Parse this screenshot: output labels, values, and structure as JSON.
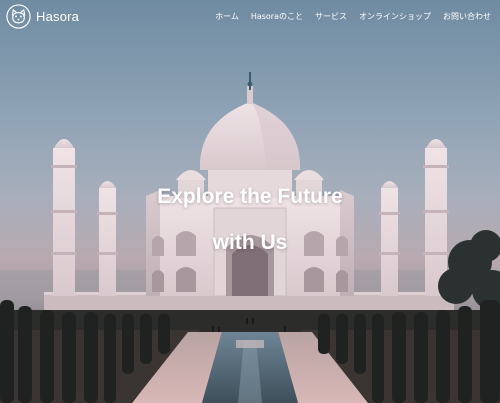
{
  "brand": {
    "name": "Hasora",
    "logo_icon": "cat-face-icon"
  },
  "nav": {
    "items": [
      {
        "label": "ホーム"
      },
      {
        "label": "Hasoraのこと"
      },
      {
        "label": "サービス"
      },
      {
        "label": "オンラインショップ"
      },
      {
        "label": "お問い合わせ"
      }
    ]
  },
  "hero": {
    "line1": "Explore the Future",
    "line2": "with Us",
    "background_image": "taj-mahal-at-dusk",
    "colors": {
      "sky_top": "#6f8ba2",
      "sky_bottom": "#b8aab0",
      "marble": "#e9dde0",
      "foliage": "#2a2b29"
    }
  }
}
